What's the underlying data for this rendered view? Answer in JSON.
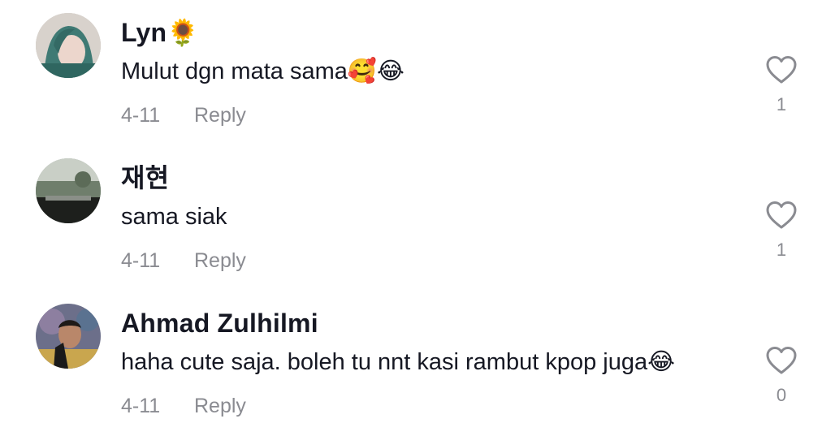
{
  "comments": [
    {
      "username": "Lyn🌻",
      "text": "Mulut dgn mata sama🥰😂",
      "date": "4-11",
      "reply_label": "Reply",
      "like_count": "1"
    },
    {
      "username": "재현",
      "text": "sama siak",
      "date": "4-11",
      "reply_label": "Reply",
      "like_count": "1"
    },
    {
      "username": "Ahmad Zulhilmi",
      "text": "haha cute saja. boleh tu nnt kasi rambut kpop juga😂",
      "date": "4-11",
      "reply_label": "Reply",
      "like_count": "0"
    }
  ],
  "icons": {
    "like": "heart-outline-icon"
  },
  "colors": {
    "text_primary": "#161823",
    "text_secondary": "#8a8b91",
    "icon": "#8a8b91"
  }
}
